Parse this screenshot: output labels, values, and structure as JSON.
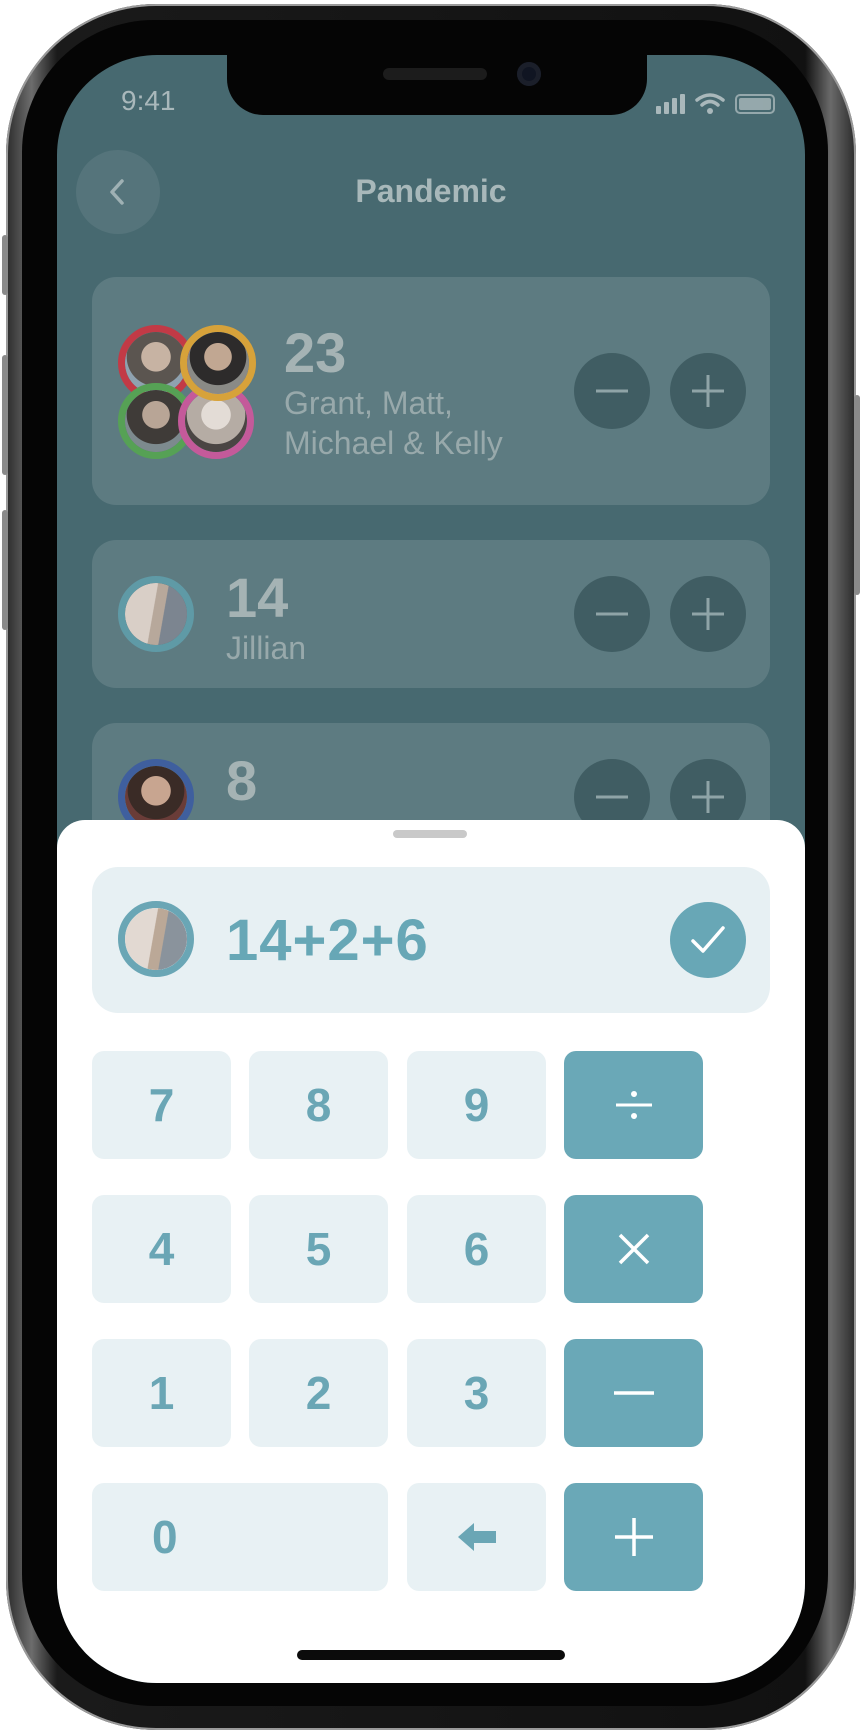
{
  "status_bar": {
    "time": "9:41"
  },
  "header": {
    "title": "Pandemic"
  },
  "players": [
    {
      "score": "23",
      "names_line1": "Grant, Matt,",
      "names_line2": "Michael & Kelly"
    },
    {
      "score": "14",
      "names_line1": "Jillian"
    },
    {
      "score": "8"
    }
  ],
  "calculator": {
    "expression": "14+2+6",
    "keys": {
      "k7": "7",
      "k8": "8",
      "k9": "9",
      "k4": "4",
      "k5": "5",
      "k6": "6",
      "k1": "1",
      "k2": "2",
      "k3": "3",
      "k0": "0"
    }
  },
  "colors": {
    "backdrop": "#476970",
    "accent": "#68a7b6",
    "key_bg": "#e8f1f4",
    "avatar_red": "#c23a46",
    "avatar_yellow": "#d7a23a",
    "avatar_green": "#56a155",
    "avatar_pink": "#c45a9a",
    "avatar_teal": "#5f9aa6",
    "avatar_blue": "#3f5f9e"
  },
  "icons": [
    "chevron-left-icon",
    "minus-icon",
    "plus-icon",
    "check-icon",
    "divide-icon",
    "multiply-icon",
    "backspace-icon",
    "signal-icon",
    "wifi-icon",
    "battery-icon"
  ]
}
